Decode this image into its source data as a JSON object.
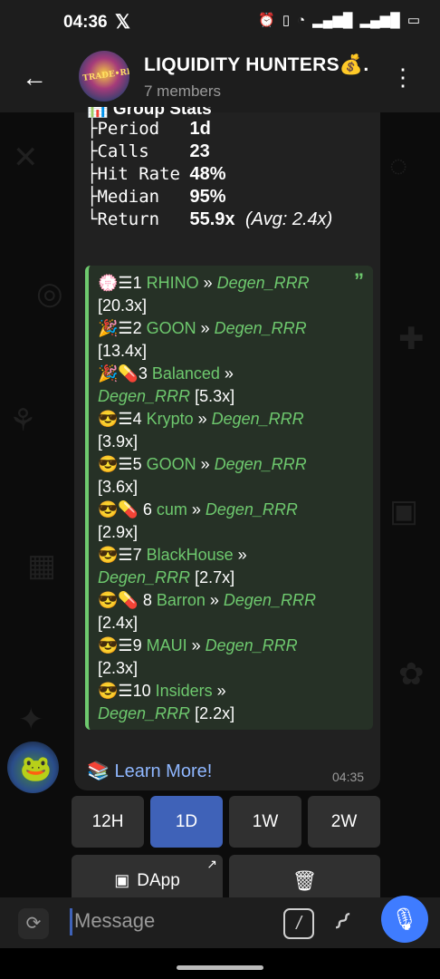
{
  "status": {
    "time": "04:36",
    "x_logo": "𝕏",
    "icons": [
      "alarm-icon",
      "vibrate-icon",
      "wifi-icon",
      "signal-4g-icon",
      "signal-4g-icon",
      "battery-icon"
    ]
  },
  "header": {
    "back": "back-arrow-icon",
    "title": "LIQUIDITY HUNTERS💰.",
    "members": "7 members",
    "avatar_text": "TRADE•RIDWAN"
  },
  "stats": {
    "heading": "📊 Group Stats",
    "rows": [
      {
        "tree": "├",
        "label": "Period",
        "value": "1d"
      },
      {
        "tree": "├",
        "label": "Calls",
        "value": "23"
      },
      {
        "tree": "├",
        "label": "Hit Rate",
        "value": "48%"
      },
      {
        "tree": "├",
        "label": "Median",
        "value": "95%"
      },
      {
        "tree": "└",
        "label": "Return",
        "value": "55.9x",
        "avg": "(Avg: 2.4x)"
      }
    ]
  },
  "leaderboard": {
    "quote_mark": "”",
    "lines": [
      [
        {
          "t": "💮☰",
          "c": ""
        },
        {
          "t": "1 ",
          "c": ""
        },
        {
          "t": "RHINO",
          "c": "nm"
        },
        {
          "t": " » ",
          "c": ""
        },
        {
          "t": "Degen_RRR",
          "c": "it"
        }
      ],
      [
        {
          "t": "[20.3x]",
          "c": ""
        }
      ],
      [
        {
          "t": "🎉☰",
          "c": ""
        },
        {
          "t": "2 ",
          "c": ""
        },
        {
          "t": "GOON",
          "c": "nm"
        },
        {
          "t": " » ",
          "c": ""
        },
        {
          "t": "Degen_RRR",
          "c": "it"
        }
      ],
      [
        {
          "t": "[13.4x]",
          "c": ""
        }
      ],
      [
        {
          "t": "🎉💊",
          "c": ""
        },
        {
          "t": "3 ",
          "c": ""
        },
        {
          "t": "Balanced",
          "c": "nm"
        },
        {
          "t": " »",
          "c": ""
        }
      ],
      [
        {
          "t": "Degen_RRR",
          "c": "it"
        },
        {
          "t": " [5.3x]",
          "c": ""
        }
      ],
      [
        {
          "t": "😎☰",
          "c": ""
        },
        {
          "t": "4 ",
          "c": ""
        },
        {
          "t": "Krypto ",
          "c": "nm"
        },
        {
          "t": " » ",
          "c": ""
        },
        {
          "t": "Degen_RRR",
          "c": "it"
        }
      ],
      [
        {
          "t": "[3.9x]",
          "c": ""
        }
      ],
      [
        {
          "t": "😎☰",
          "c": ""
        },
        {
          "t": "5 ",
          "c": ""
        },
        {
          "t": "GOON",
          "c": "nm"
        },
        {
          "t": " » ",
          "c": ""
        },
        {
          "t": "Degen_RRR",
          "c": "it"
        }
      ],
      [
        {
          "t": "[3.6x]",
          "c": ""
        }
      ],
      [
        {
          "t": "😎💊",
          "c": ""
        },
        {
          "t": " 6 ",
          "c": ""
        },
        {
          "t": "cum",
          "c": "nm"
        },
        {
          "t": " » ",
          "c": ""
        },
        {
          "t": "Degen_RRR",
          "c": "it"
        }
      ],
      [
        {
          "t": "[2.9x]",
          "c": ""
        }
      ],
      [
        {
          "t": "😎☰",
          "c": ""
        },
        {
          "t": "7 ",
          "c": ""
        },
        {
          "t": "BlackHouse",
          "c": "nm"
        },
        {
          "t": " »",
          "c": ""
        }
      ],
      [
        {
          "t": "Degen_RRR",
          "c": "it"
        },
        {
          "t": " [2.7x]",
          "c": ""
        }
      ],
      [
        {
          "t": "😎💊",
          "c": ""
        },
        {
          "t": " 8 ",
          "c": ""
        },
        {
          "t": "Barron",
          "c": "nm"
        },
        {
          "t": " » ",
          "c": ""
        },
        {
          "t": "Degen_RRR",
          "c": "it"
        }
      ],
      [
        {
          "t": "[2.4x]",
          "c": ""
        }
      ],
      [
        {
          "t": "😎☰",
          "c": ""
        },
        {
          "t": "9 ",
          "c": ""
        },
        {
          "t": "MAUI",
          "c": "nm"
        },
        {
          "t": " » ",
          "c": ""
        },
        {
          "t": "Degen_RRR",
          "c": "it"
        }
      ],
      [
        {
          "t": "[2.3x]",
          "c": ""
        }
      ],
      [
        {
          "t": "😎☰",
          "c": ""
        },
        {
          "t": "10 ",
          "c": ""
        },
        {
          "t": "Insiders",
          "c": "nm"
        },
        {
          "t": " »",
          "c": ""
        }
      ],
      [
        {
          "t": "Degen_RRR",
          "c": "it"
        },
        {
          "t": " [2.2x]",
          "c": ""
        }
      ]
    ]
  },
  "footer_link": "📚 Learn More!",
  "timestamp": "04:35",
  "keyboard": {
    "row1": [
      {
        "label": "12H",
        "selected": false
      },
      {
        "label": "1D",
        "selected": true
      },
      {
        "label": "1W",
        "selected": false
      },
      {
        "label": "2W",
        "selected": false
      }
    ],
    "dapp": "DApp",
    "dapp_icon": "screen-chart-icon",
    "delete_icon": "trash-icon"
  },
  "input": {
    "placeholder": "Message"
  },
  "colors": {
    "accent": "#3f62b8",
    "green": "#6ec96e",
    "mic": "#3f7cff"
  }
}
